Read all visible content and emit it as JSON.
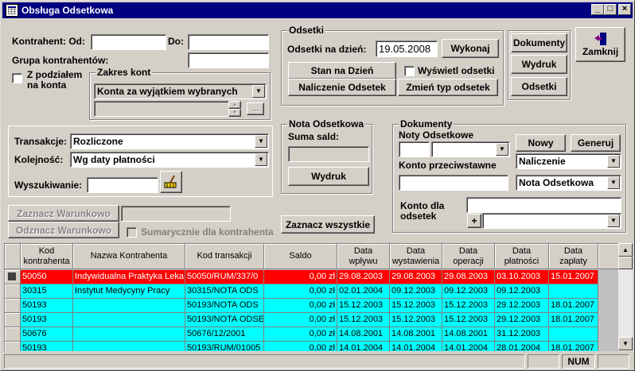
{
  "window": {
    "title": "Obsługa Odsetkowa"
  },
  "filters": {
    "kontrahent_od_label": "Kontrahent: Od:",
    "kontrahent_do_label": "Do:",
    "kontrahent_od_value": "",
    "kontrahent_do_value": "",
    "grupa_label": "Grupa kontrahentów:",
    "grupa_value": "",
    "podzial_label_1": "Z podziałem",
    "podzial_label_2": "na konta",
    "zakres_title": "Zakres kont",
    "zakres_value": "Konta za wyjątkiem wybranych",
    "zakres_konto_value": "",
    "zakres_dots": "...",
    "transakcje_label": "Transakcje:",
    "transakcje_value": "Rozliczone",
    "kolejnosc_label": "Kolejność:",
    "kolejnosc_value": "Wg daty płatności",
    "wyszukiwanie_label": "Wyszukiwanie:",
    "wyszukiwanie_value": ""
  },
  "odsetki": {
    "group_title": "Odsetki",
    "na_dzien_label": "Odsetki na dzień:",
    "date_value": "19.05.2008",
    "wykonaj": "Wykonaj",
    "stan_na_dzien": "Stan na Dzień",
    "wyswietl_label": "Wyświetl odsetki",
    "naliczenie": "Naliczenie Odsetek",
    "zmien_typ": "Zmień typ odsetek"
  },
  "side_buttons": {
    "dokumenty": "Dokumenty",
    "wydruk": "Wydruk",
    "odsetki": "Odsetki",
    "zamknij": "Zamknij"
  },
  "nota": {
    "group_title": "Nota Odsetkowa",
    "suma_label": "Suma sald:",
    "suma_value": "",
    "wydruk": "Wydruk"
  },
  "dokumenty": {
    "group_title": "Dokumenty",
    "noty_label": "Noty Odsetkowe",
    "noty_value_1": "",
    "noty_value_2": "",
    "nowy": "Nowy",
    "generuj": "Generuj",
    "konto_przec_label": "Konto przeciwstawne",
    "konto_przec_value": "",
    "naliczenie_value": "Naliczenie",
    "nota_value": "Nota Odsetkowa",
    "konto_dla_label_1": "Konto dla",
    "konto_dla_label_2": "odsetek",
    "konto_dla_value": "",
    "konto_dla_combo": "",
    "plus": "+"
  },
  "actions": {
    "zaznacz_warunkowo": "Zaznacz Warunkowo",
    "odznacz_warunkowo": "Odznacz Warunkowo",
    "warunek_value": "",
    "sumarycznie_label": "Sumarycznie dla kontrahenta",
    "zaznacz_wszystkie": "Zaznacz wszystkie"
  },
  "table": {
    "columns": [
      "Kod\nkontrahenta",
      "Nazwa Kontrahenta",
      "Kod transakcji",
      "Saldo",
      "Data\nwpływu",
      "Data\nwystawienia",
      "Data\noperacji",
      "Data\npłatności",
      "Data\nzapłaty"
    ],
    "rows": [
      [
        "50050",
        "Indywidualna Praktyka Leka",
        "50050/RUM/337/0",
        "0,00 zł",
        "29.08.2003",
        "29.08.2003",
        "29.08.2003",
        "03.10.2003",
        "15.01.2007"
      ],
      [
        "30315",
        "Instytut Medycyny Pracy",
        "30315/NOTA ODS",
        "0,00 zł",
        "02.01.2004",
        "09.12.2003",
        "09.12.2003",
        "09.12.2003",
        ""
      ],
      [
        "50193",
        "",
        "50193/NOTA ODS",
        "0,00 zł",
        "15.12.2003",
        "15.12.2003",
        "15.12.2003",
        "29.12.2003",
        "18.01.2007"
      ],
      [
        "50193",
        "",
        "50193/NOTA ODSE",
        "0,00 zł",
        "15.12.2003",
        "15.12.2003",
        "15.12.2003",
        "29.12.2003",
        "18.01.2007"
      ],
      [
        "50676",
        "",
        "50676/12/2001",
        "0,00 zł",
        "14.08.2001",
        "14.08.2001",
        "14.08.2001",
        "31.12.2003",
        ""
      ],
      [
        "50193",
        "",
        "50193/RUM/01005",
        "0,00 zł",
        "14.01.2004",
        "14.01.2004",
        "14.01.2004",
        "28.01.2004",
        "18.01.2007"
      ]
    ]
  },
  "status": {
    "num": "NUM"
  },
  "colors": {
    "selected_row": "#ff0000",
    "row": "#00ffff",
    "title_bar": "#000080"
  }
}
